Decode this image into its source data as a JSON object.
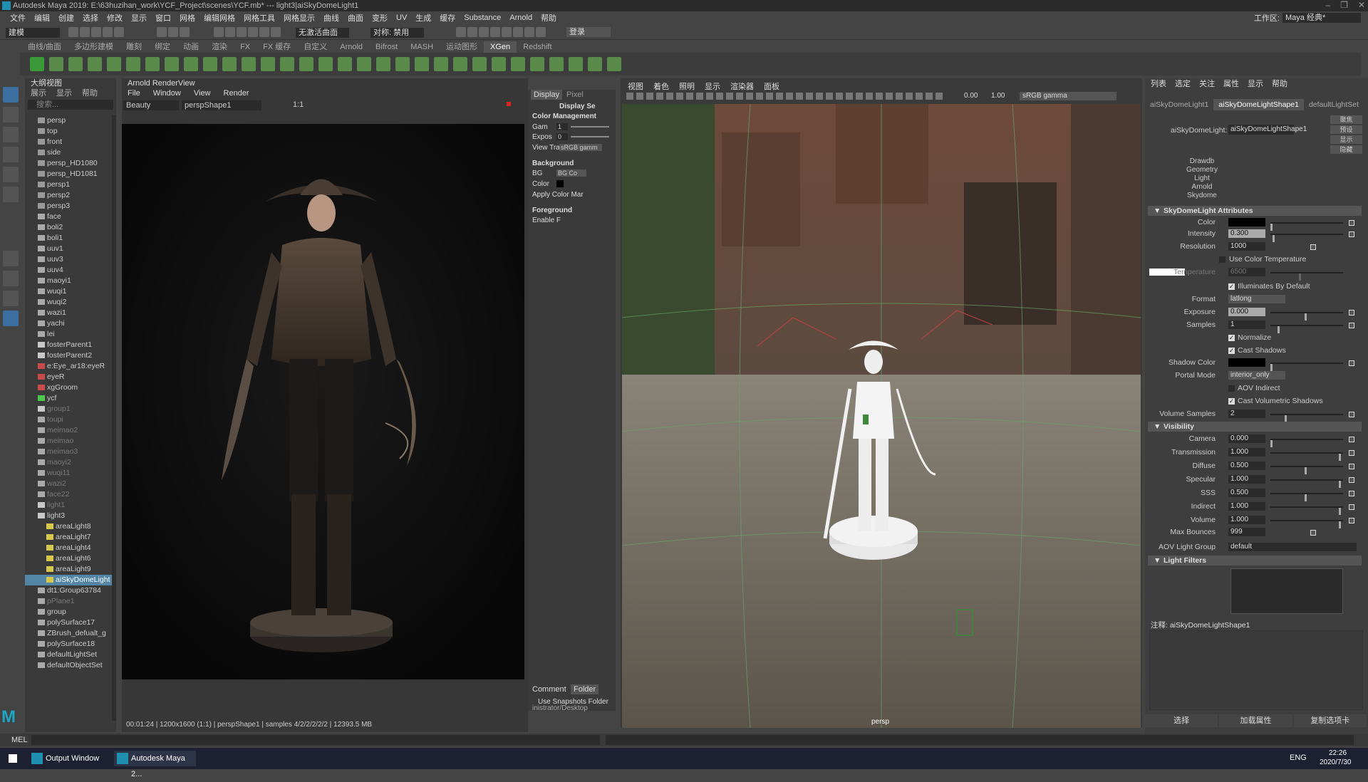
{
  "title_bar": {
    "text": "Autodesk Maya 2019: E:\\63huzihan_work\\YCF_Project\\scenes\\YCF.mb* --- light3|aiSkyDomeLight1"
  },
  "menu_bar": [
    "文件",
    "编辑",
    "创建",
    "选择",
    "修改",
    "显示",
    "窗口",
    "网格",
    "编辑网格",
    "网格工具",
    "网格显示",
    "曲线",
    "曲面",
    "变形",
    "UV",
    "生成",
    "缓存",
    "Substance",
    "Arnold",
    "帮助"
  ],
  "workspace": {
    "label": "工作区:",
    "value": "Maya 经典*"
  },
  "status_line": {
    "menu_set": "建模",
    "snap_label": "无激活曲面",
    "symmetry": "对称: 禁用",
    "login": "登录"
  },
  "shelf_tabs": [
    "曲线/曲面",
    "多边形建模",
    "雕刻",
    "绑定",
    "动画",
    "渲染",
    "FX",
    "FX 缓存",
    "自定义",
    "Arnold",
    "Bifrost",
    "MASH",
    "运动图形",
    "XGen",
    "Redshift"
  ],
  "shelf_active_tab": "XGen",
  "outliner": {
    "title": "大纲视图",
    "menus": [
      "展示",
      "显示",
      "帮助"
    ],
    "search_placeholder": "搜索...",
    "items": [
      {
        "label": "persp",
        "icon": "camera",
        "state": "normal"
      },
      {
        "label": "top",
        "icon": "camera",
        "state": "normal"
      },
      {
        "label": "front",
        "icon": "camera",
        "state": "normal"
      },
      {
        "label": "side",
        "icon": "camera",
        "state": "normal"
      },
      {
        "label": "persp_HD1080",
        "icon": "camera",
        "state": "normal"
      },
      {
        "label": "persp_HD1081",
        "icon": "camera",
        "state": "normal"
      },
      {
        "label": "persp1",
        "icon": "camera",
        "state": "normal"
      },
      {
        "label": "persp2",
        "icon": "camera",
        "state": "normal"
      },
      {
        "label": "persp3",
        "icon": "camera",
        "state": "normal"
      },
      {
        "label": "face",
        "icon": "mesh",
        "state": "normal"
      },
      {
        "label": "boli2",
        "icon": "mesh",
        "state": "normal"
      },
      {
        "label": "boli1",
        "icon": "mesh",
        "state": "normal"
      },
      {
        "label": "uuv1",
        "icon": "mesh",
        "state": "normal"
      },
      {
        "label": "uuv3",
        "icon": "mesh",
        "state": "normal"
      },
      {
        "label": "uuv4",
        "icon": "mesh",
        "state": "normal"
      },
      {
        "label": "maoyi1",
        "icon": "mesh",
        "state": "normal"
      },
      {
        "label": "wuqi1",
        "icon": "mesh",
        "state": "normal"
      },
      {
        "label": "wuqi2",
        "icon": "mesh",
        "state": "normal"
      },
      {
        "label": "wazi1",
        "icon": "mesh",
        "state": "normal"
      },
      {
        "label": "yachi",
        "icon": "mesh",
        "state": "normal"
      },
      {
        "label": "lei",
        "icon": "mesh",
        "state": "normal"
      },
      {
        "label": "fosterParent1",
        "icon": "group",
        "state": "normal"
      },
      {
        "label": "fosterParent2",
        "icon": "group",
        "state": "normal"
      },
      {
        "label": "e:Eye_ar18:eyeR",
        "icon": "group-red",
        "state": "normal"
      },
      {
        "label": "eyeR",
        "icon": "group-red",
        "state": "normal"
      },
      {
        "label": "xgGroom",
        "icon": "group-red",
        "state": "normal"
      },
      {
        "label": "ycf",
        "icon": "group-green",
        "state": "normal"
      },
      {
        "label": "group1",
        "icon": "group",
        "state": "dim"
      },
      {
        "label": "toupi",
        "icon": "mesh",
        "state": "dim"
      },
      {
        "label": "meimao2",
        "icon": "mesh",
        "state": "dim"
      },
      {
        "label": "meimao",
        "icon": "mesh",
        "state": "dim"
      },
      {
        "label": "meimao3",
        "icon": "mesh",
        "state": "dim"
      },
      {
        "label": "maoyi2",
        "icon": "mesh",
        "state": "dim"
      },
      {
        "label": "wuqi11",
        "icon": "mesh",
        "state": "dim"
      },
      {
        "label": "wazi2",
        "icon": "mesh",
        "state": "dim"
      },
      {
        "label": "face22",
        "icon": "mesh",
        "state": "dim"
      },
      {
        "label": "light1",
        "icon": "group",
        "state": "dim"
      },
      {
        "label": "light3",
        "icon": "group",
        "state": "normal"
      },
      {
        "label": "areaLight8",
        "icon": "light",
        "state": "normal"
      },
      {
        "label": "areaLight7",
        "icon": "light",
        "state": "normal"
      },
      {
        "label": "areaLight4",
        "icon": "light",
        "state": "normal"
      },
      {
        "label": "areaLight6",
        "icon": "light",
        "state": "normal"
      },
      {
        "label": "areaLight9",
        "icon": "light",
        "state": "normal"
      },
      {
        "label": "aiSkyDomeLight",
        "icon": "light",
        "state": "selected"
      },
      {
        "label": "dt1:Group63784",
        "icon": "mesh",
        "state": "normal"
      },
      {
        "label": "pPlane1",
        "icon": "mesh",
        "state": "dim"
      },
      {
        "label": "group",
        "icon": "mesh",
        "state": "normal"
      },
      {
        "label": "polySurface17",
        "icon": "mesh",
        "state": "normal"
      },
      {
        "label": "ZBrush_defualt_g",
        "icon": "mesh",
        "state": "normal"
      },
      {
        "label": "polySurface18",
        "icon": "mesh",
        "state": "normal"
      },
      {
        "label": "defaultLightSet",
        "icon": "set",
        "state": "normal"
      },
      {
        "label": "defaultObjectSet",
        "icon": "set",
        "state": "normal"
      }
    ]
  },
  "render_view": {
    "title": "Arnold RenderView",
    "menus": [
      "File",
      "Window",
      "View",
      "Render"
    ],
    "aov": "Beauty",
    "camera": "perspShape1",
    "ratio": "1:1",
    "status": "00:01:24 | 1200x1600 (1:1) | perspShape1 | samples 4/2/2/2/2/2 | 12393.5 MB"
  },
  "display_panel": {
    "tabs": [
      "Display",
      "Pixel"
    ],
    "heading": "Display Se",
    "color_management": "Color Management",
    "gamma_label": "Gam",
    "gamma_value": "1",
    "exposure_label": "Expos",
    "exposure_value": "0",
    "view_transform_label": "View Trans",
    "view_transform_value": "sRGB gamm",
    "background": "Background",
    "bg_label": "BG",
    "bg_value": "BG Co",
    "color_label": "Color",
    "apply_label": "Apply Color Mar",
    "foreground": "Foreground",
    "enable_label": "Enable F",
    "bottom_tabs": [
      "Comment",
      "Folder"
    ],
    "snapshot_label": "Use Snapshots Folder",
    "snapshot_path": "inistrator/Desktop"
  },
  "viewport": {
    "menus": [
      "视图",
      "着色",
      "照明",
      "显示",
      "渲染器",
      "面板"
    ],
    "value1": "0.00",
    "value2": "1.00",
    "color_space": "sRGB gamma",
    "camera_label": "persp"
  },
  "attribute_editor": {
    "menus": [
      "列表",
      "选定",
      "关注",
      "属性",
      "显示",
      "帮助"
    ],
    "tabs": [
      "aiSkyDomeLight1",
      "aiSkyDomeLightShape1",
      "defaultLightSet"
    ],
    "active_tab": "aiSkyDomeLightShape1",
    "node_label": "aiSkyDomeLight:",
    "node_value": "aiSkyDomeLightShape1",
    "side_buttons": [
      "聚焦",
      "预设",
      "显示",
      "隐藏"
    ],
    "categories": [
      "Drawdb",
      "Geometry",
      "Light",
      "Arnold",
      "Skydome"
    ],
    "section_skydome": "SkyDomeLight Attributes",
    "attrs": {
      "color_label": "Color",
      "intensity_label": "Intensity",
      "intensity": "0.300",
      "resolution_label": "Resolution",
      "resolution": "1000",
      "use_color_temp": "Use Color Temperature",
      "temperature_label": "Temperature",
      "temperature": "6500",
      "illuminates": "Illuminates By Default",
      "format_label": "Format",
      "format": "latlong",
      "exposure_label": "Exposure",
      "exposure": "0.000",
      "samples_label": "Samples",
      "samples": "1",
      "normalize": "Normalize",
      "cast_shadows": "Cast Shadows",
      "shadow_color_label": "Shadow Color",
      "portal_label": "Portal Mode",
      "portal": "interior_only",
      "aov_indirect": "AOV Indirect",
      "cast_volumetric": "Cast Volumetric Shadows",
      "volume_samples_label": "Volume Samples",
      "volume_samples": "2"
    },
    "section_visibility": "Visibility",
    "visibility": [
      {
        "label": "Camera",
        "value": "0.000",
        "pos": 0.0
      },
      {
        "label": "Transmission",
        "value": "1.000",
        "pos": 1.0
      },
      {
        "label": "Diffuse",
        "value": "0.500",
        "pos": 0.5
      },
      {
        "label": "Specular",
        "value": "1.000",
        "pos": 1.0
      },
      {
        "label": "SSS",
        "value": "0.500",
        "pos": 0.5
      },
      {
        "label": "Indirect",
        "value": "1.000",
        "pos": 1.0
      },
      {
        "label": "Volume",
        "value": "1.000",
        "pos": 1.0
      }
    ],
    "max_bounces_label": "Max Bounces",
    "max_bounces": "999",
    "aov_group_label": "AOV Light Group",
    "aov_group": "default",
    "section_filters": "Light Filters",
    "notes": "注释: aiSkyDomeLightShape1",
    "buttons": [
      "选择",
      "加载属性",
      "复制选项卡"
    ]
  },
  "command_line": {
    "label": "MEL"
  },
  "taskbar": {
    "items": [
      "Output Window",
      "Autodesk Maya 2..."
    ],
    "lang": "ENG",
    "time": "22:26",
    "date": "2020/7/30"
  },
  "colors": {
    "selection": "#5285a6",
    "panel": "#444444",
    "dark": "#2b2b2b"
  }
}
